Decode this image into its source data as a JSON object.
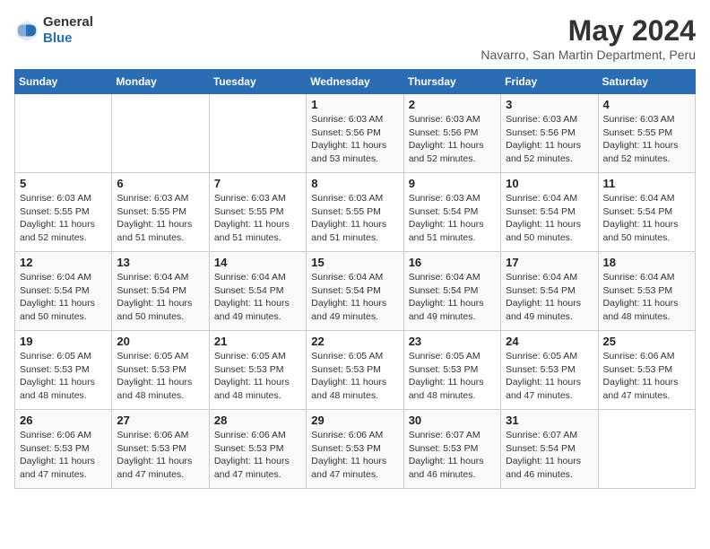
{
  "header": {
    "logo_general": "General",
    "logo_blue": "Blue",
    "month_year": "May 2024",
    "location": "Navarro, San Martin Department, Peru"
  },
  "days_of_week": [
    "Sunday",
    "Monday",
    "Tuesday",
    "Wednesday",
    "Thursday",
    "Friday",
    "Saturday"
  ],
  "weeks": [
    [
      {
        "day": "",
        "info": ""
      },
      {
        "day": "",
        "info": ""
      },
      {
        "day": "",
        "info": ""
      },
      {
        "day": "1",
        "info": "Sunrise: 6:03 AM\nSunset: 5:56 PM\nDaylight: 11 hours and 53 minutes."
      },
      {
        "day": "2",
        "info": "Sunrise: 6:03 AM\nSunset: 5:56 PM\nDaylight: 11 hours and 52 minutes."
      },
      {
        "day": "3",
        "info": "Sunrise: 6:03 AM\nSunset: 5:56 PM\nDaylight: 11 hours and 52 minutes."
      },
      {
        "day": "4",
        "info": "Sunrise: 6:03 AM\nSunset: 5:55 PM\nDaylight: 11 hours and 52 minutes."
      }
    ],
    [
      {
        "day": "5",
        "info": "Sunrise: 6:03 AM\nSunset: 5:55 PM\nDaylight: 11 hours and 52 minutes."
      },
      {
        "day": "6",
        "info": "Sunrise: 6:03 AM\nSunset: 5:55 PM\nDaylight: 11 hours and 51 minutes."
      },
      {
        "day": "7",
        "info": "Sunrise: 6:03 AM\nSunset: 5:55 PM\nDaylight: 11 hours and 51 minutes."
      },
      {
        "day": "8",
        "info": "Sunrise: 6:03 AM\nSunset: 5:55 PM\nDaylight: 11 hours and 51 minutes."
      },
      {
        "day": "9",
        "info": "Sunrise: 6:03 AM\nSunset: 5:54 PM\nDaylight: 11 hours and 51 minutes."
      },
      {
        "day": "10",
        "info": "Sunrise: 6:04 AM\nSunset: 5:54 PM\nDaylight: 11 hours and 50 minutes."
      },
      {
        "day": "11",
        "info": "Sunrise: 6:04 AM\nSunset: 5:54 PM\nDaylight: 11 hours and 50 minutes."
      }
    ],
    [
      {
        "day": "12",
        "info": "Sunrise: 6:04 AM\nSunset: 5:54 PM\nDaylight: 11 hours and 50 minutes."
      },
      {
        "day": "13",
        "info": "Sunrise: 6:04 AM\nSunset: 5:54 PM\nDaylight: 11 hours and 50 minutes."
      },
      {
        "day": "14",
        "info": "Sunrise: 6:04 AM\nSunset: 5:54 PM\nDaylight: 11 hours and 49 minutes."
      },
      {
        "day": "15",
        "info": "Sunrise: 6:04 AM\nSunset: 5:54 PM\nDaylight: 11 hours and 49 minutes."
      },
      {
        "day": "16",
        "info": "Sunrise: 6:04 AM\nSunset: 5:54 PM\nDaylight: 11 hours and 49 minutes."
      },
      {
        "day": "17",
        "info": "Sunrise: 6:04 AM\nSunset: 5:54 PM\nDaylight: 11 hours and 49 minutes."
      },
      {
        "day": "18",
        "info": "Sunrise: 6:04 AM\nSunset: 5:53 PM\nDaylight: 11 hours and 48 minutes."
      }
    ],
    [
      {
        "day": "19",
        "info": "Sunrise: 6:05 AM\nSunset: 5:53 PM\nDaylight: 11 hours and 48 minutes."
      },
      {
        "day": "20",
        "info": "Sunrise: 6:05 AM\nSunset: 5:53 PM\nDaylight: 11 hours and 48 minutes."
      },
      {
        "day": "21",
        "info": "Sunrise: 6:05 AM\nSunset: 5:53 PM\nDaylight: 11 hours and 48 minutes."
      },
      {
        "day": "22",
        "info": "Sunrise: 6:05 AM\nSunset: 5:53 PM\nDaylight: 11 hours and 48 minutes."
      },
      {
        "day": "23",
        "info": "Sunrise: 6:05 AM\nSunset: 5:53 PM\nDaylight: 11 hours and 48 minutes."
      },
      {
        "day": "24",
        "info": "Sunrise: 6:05 AM\nSunset: 5:53 PM\nDaylight: 11 hours and 47 minutes."
      },
      {
        "day": "25",
        "info": "Sunrise: 6:06 AM\nSunset: 5:53 PM\nDaylight: 11 hours and 47 minutes."
      }
    ],
    [
      {
        "day": "26",
        "info": "Sunrise: 6:06 AM\nSunset: 5:53 PM\nDaylight: 11 hours and 47 minutes."
      },
      {
        "day": "27",
        "info": "Sunrise: 6:06 AM\nSunset: 5:53 PM\nDaylight: 11 hours and 47 minutes."
      },
      {
        "day": "28",
        "info": "Sunrise: 6:06 AM\nSunset: 5:53 PM\nDaylight: 11 hours and 47 minutes."
      },
      {
        "day": "29",
        "info": "Sunrise: 6:06 AM\nSunset: 5:53 PM\nDaylight: 11 hours and 47 minutes."
      },
      {
        "day": "30",
        "info": "Sunrise: 6:07 AM\nSunset: 5:53 PM\nDaylight: 11 hours and 46 minutes."
      },
      {
        "day": "31",
        "info": "Sunrise: 6:07 AM\nSunset: 5:54 PM\nDaylight: 11 hours and 46 minutes."
      },
      {
        "day": "",
        "info": ""
      }
    ]
  ]
}
